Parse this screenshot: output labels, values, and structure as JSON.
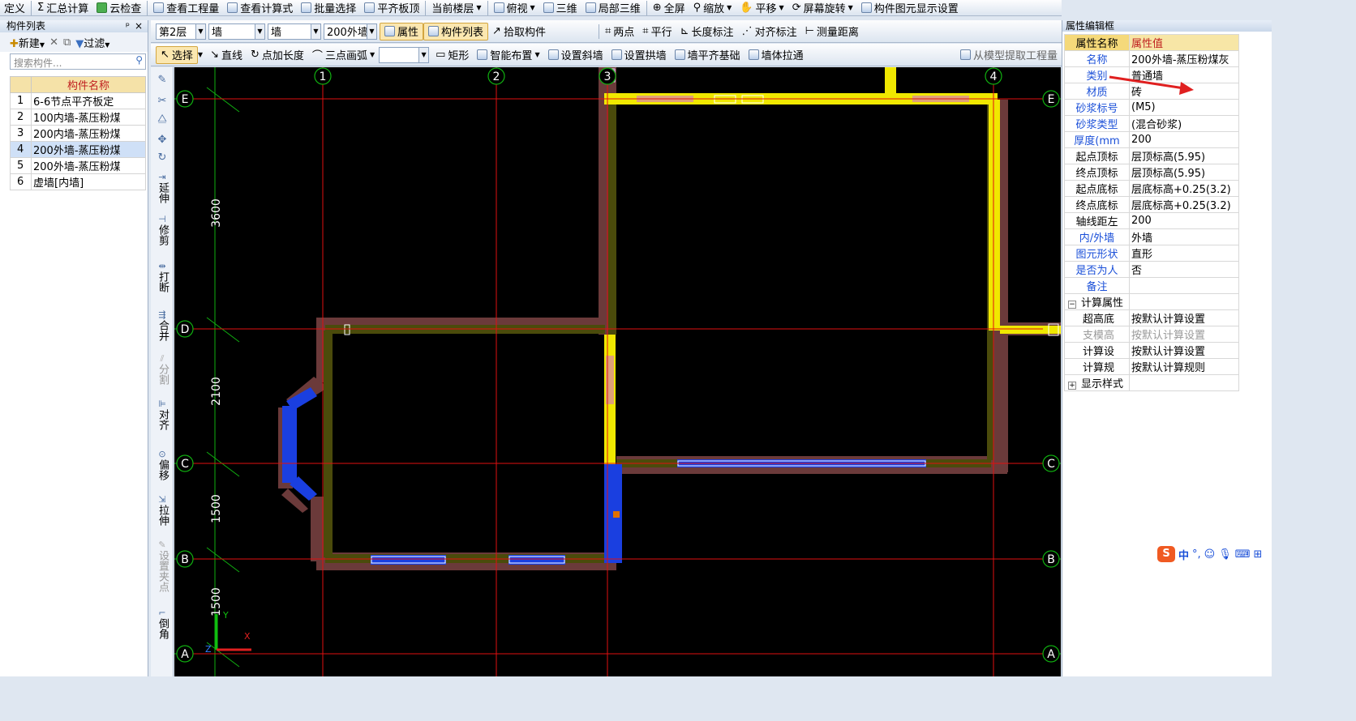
{
  "toolbar1": {
    "items": [
      "定义",
      "汇总计算",
      "云检查",
      "查看工程量",
      "查看计算式",
      "批量选择",
      "平齐板顶",
      "当前楼层",
      "俯视",
      "三维",
      "局部三维",
      "全屏",
      "缩放",
      "平移",
      "屏幕旋转",
      "构件图元显示设置"
    ]
  },
  "toolbar2": {
    "floor": "第2层",
    "type1": "墙",
    "type2": "墙",
    "component": "200外墙",
    "props_btn": "属性",
    "list_btn": "构件列表",
    "pick": "拾取构件",
    "two_point": "两点",
    "parallel": "平行",
    "len_mark": "长度标注",
    "align_mark": "对齐标注",
    "measure": "测量距离"
  },
  "toolbar3": {
    "select": "选择",
    "line": "直线",
    "point_len": "点加长度",
    "arc3": "三点画弧",
    "rect": "矩形",
    "smart": "智能布置",
    "slope_wall": "设置斜墙",
    "arch_wall": "设置拱墙",
    "wall_base": "墙平齐基础",
    "wall_pull": "墙体拉通",
    "extract": "从模型提取工程量"
  },
  "left_panel": {
    "title": "构件列表",
    "pin": "ᵖ",
    "close": "×",
    "new_btn": "新建",
    "filter_btn": "过滤",
    "search_placeholder": "搜索构件...",
    "col_name": "构件名称",
    "rows": [
      {
        "n": "1",
        "name": "6-6节点平齐板定"
      },
      {
        "n": "2",
        "name": "100内墙-蒸压粉煤"
      },
      {
        "n": "3",
        "name": "200内墙-蒸压粉煤"
      },
      {
        "n": "4",
        "name": "200外墙-蒸压粉煤"
      },
      {
        "n": "5",
        "name": "200外墙-蒸压粉煤"
      },
      {
        "n": "6",
        "name": "虚墙[内墙]"
      }
    ]
  },
  "vtools": [
    "延伸",
    "修剪",
    "打断",
    "合并",
    "分割",
    "对齐",
    "偏移",
    "拉伸",
    "设置夹点",
    "倒角"
  ],
  "canvas": {
    "axes_x": [
      "1",
      "2",
      "3",
      "4"
    ],
    "axes_y": [
      "E",
      "D",
      "C",
      "B",
      "A"
    ],
    "dims": [
      "3600",
      "2100",
      "1500",
      "1500"
    ],
    "ucs_x": "X",
    "ucs_y": "Y",
    "ucs_z": "Z"
  },
  "right_panel": {
    "title": "属性编辑框",
    "col_key": "属性名称",
    "col_val": "属性值",
    "rows": [
      {
        "k": "名称",
        "v": "200外墙-蒸压粉煤灰",
        "blue": true
      },
      {
        "k": "类别",
        "v": "普通墙",
        "blue": true
      },
      {
        "k": "材质",
        "v": "砖",
        "blue": true
      },
      {
        "k": "砂浆标号",
        "v": "(M5)",
        "blue": true
      },
      {
        "k": "砂浆类型",
        "v": "(混合砂浆)",
        "blue": true
      },
      {
        "k": "厚度(mm",
        "v": "200",
        "blue": true
      },
      {
        "k": "起点顶标",
        "v": "层顶标高(5.95)",
        "blue": false
      },
      {
        "k": "终点顶标",
        "v": "层顶标高(5.95)",
        "blue": false
      },
      {
        "k": "起点底标",
        "v": "层底标高+0.25(3.2)",
        "blue": false
      },
      {
        "k": "终点底标",
        "v": "层底标高+0.25(3.2)",
        "blue": false
      },
      {
        "k": "轴线距左",
        "v": "200",
        "blue": false
      },
      {
        "k": "内/外墙",
        "v": "外墙",
        "blue": true
      },
      {
        "k": "图元形状",
        "v": "直形",
        "blue": true
      },
      {
        "k": "是否为人",
        "v": "否",
        "blue": true
      },
      {
        "k": "备注",
        "v": "",
        "blue": true
      }
    ],
    "group_calc": "计算属性",
    "group_calc_toggle": "−",
    "sub_rows": [
      {
        "k": "超高底",
        "v": "按默认计算设置",
        "gray": false
      },
      {
        "k": "支模高",
        "v": "按默认计算设置",
        "gray": true
      },
      {
        "k": "计算设",
        "v": "按默认计算设置",
        "gray": false
      },
      {
        "k": "计算规",
        "v": "按默认计算规则",
        "gray": false
      }
    ],
    "group_display": "显示样式",
    "group_display_toggle": "+"
  },
  "ime": {
    "logo": "S",
    "lang": "中",
    "punct": "°,"
  }
}
